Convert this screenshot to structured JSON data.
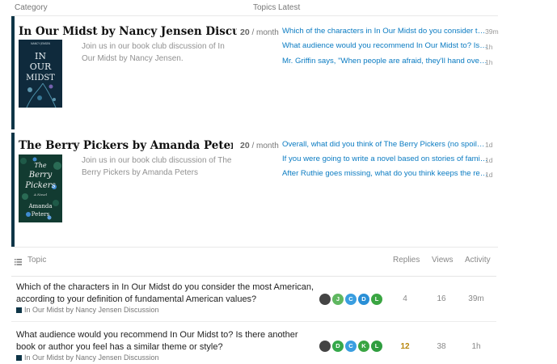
{
  "header": {
    "category": "Category",
    "topics": "Topics",
    "latest": "Latest"
  },
  "categories": [
    {
      "title": "In Our Midst by Nancy Jensen Discussion",
      "description": "Join us in our book club discussion of In Our Midst by Nancy Jensen.",
      "topics_count": "20",
      "topics_unit": "/ month",
      "cover": {
        "author": "NANCY JENSEN",
        "words": [
          "IN",
          "OUR",
          "MIDST"
        ],
        "bg": "#0f2a3c",
        "accent": "#6fb0c9"
      },
      "latest": [
        {
          "title": "Which of the characters in In Our Midst do you consider the most American, according to your definition of fundamental American values?",
          "age": "39m"
        },
        {
          "title": "What audience would you recommend In Our Midst to? Is there another book or author you feel has a similar theme or style?",
          "age": "1h"
        },
        {
          "title": "Mr. Griffin says, \"When people are afraid, they'll hand over their freedom.\"",
          "age": "1h"
        }
      ]
    },
    {
      "title": "The Berry Pickers by Amanda Peters Discussion",
      "description": "Join us in our book club discussion of The Berry Pickers by Amanda Peters",
      "topics_count": "20",
      "topics_unit": "/ month",
      "cover": {
        "words": [
          "The",
          "Berry",
          "Pickers"
        ],
        "sub": "A Novel",
        "author": [
          "Amanda",
          "Peters"
        ],
        "bg": "#123b31",
        "accent": "#3f8bd1"
      },
      "latest": [
        {
          "title": "Overall, what did you think of The Berry Pickers (no spoilers, please)?",
          "age": "1d"
        },
        {
          "title": "If you were going to write a novel based on stories of family history, what would you write about?",
          "age": "1d"
        },
        {
          "title": "After Ruthie goes missing, what do you think keeps the remaining family together?",
          "age": "1d"
        }
      ]
    }
  ],
  "table_header": {
    "topic": "Topic",
    "replies": "Replies",
    "views": "Views",
    "activity": "Activity"
  },
  "topics": [
    {
      "title": "Which of the characters in In Our Midst do you consider the most American, according to your definition of fundamental American values?",
      "category": "In Our Midst by Nancy Jensen Discussion",
      "avatars": [
        {
          "letter": "",
          "color": "#444444"
        },
        {
          "letter": "J",
          "color": "#5fb760"
        },
        {
          "letter": "C",
          "color": "#3a9ee0"
        },
        {
          "letter": "D",
          "color": "#2a8fd6"
        },
        {
          "letter": "L",
          "color": "#3aa542"
        }
      ],
      "replies": "4",
      "views": "16",
      "activity": "39m",
      "replies_color": "#888888"
    },
    {
      "title": "What audience would you recommend In Our Midst to? Is there another book or author you feel has a similar theme or style?",
      "category": "In Our Midst by Nancy Jensen Discussion",
      "avatars": [
        {
          "letter": "",
          "color": "#444444"
        },
        {
          "letter": "D",
          "color": "#35a84a"
        },
        {
          "letter": "C",
          "color": "#3a9ee0"
        },
        {
          "letter": "K",
          "color": "#3aa542"
        },
        {
          "letter": "L",
          "color": "#2f9d3f"
        }
      ],
      "replies": "12",
      "views": "38",
      "activity": "1h",
      "replies_color": "#b8860b"
    }
  ],
  "colors": {
    "category_bar": "#0e3547",
    "link": "#0a7bc2"
  }
}
